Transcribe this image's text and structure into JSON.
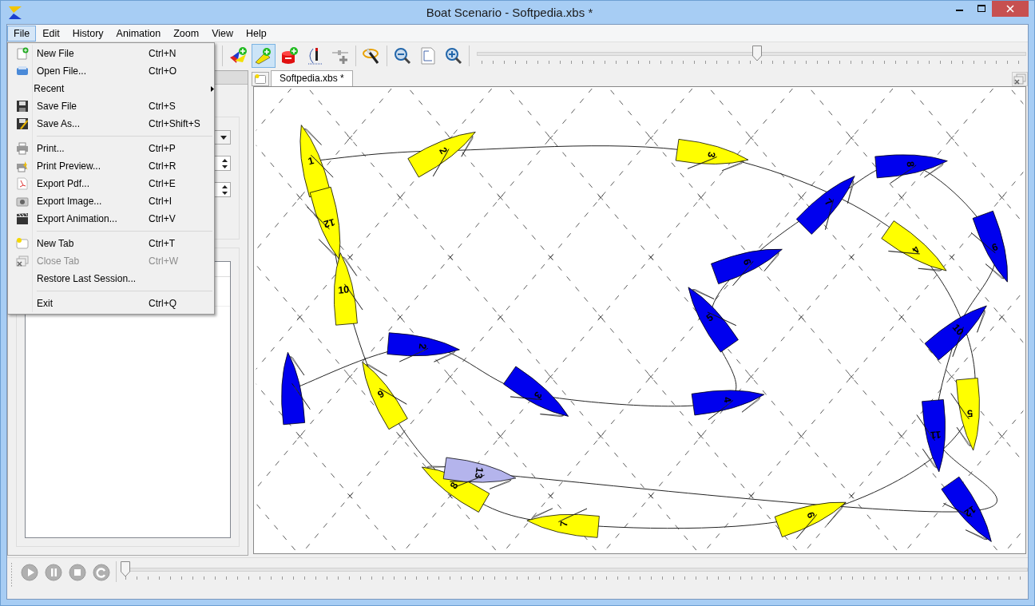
{
  "window": {
    "title": "Boat Scenario - Softpedia.xbs *"
  },
  "menu_bar": [
    {
      "label": "File",
      "selected": true
    },
    {
      "label": "Edit",
      "selected": false
    },
    {
      "label": "History",
      "selected": false
    },
    {
      "label": "Animation",
      "selected": false
    },
    {
      "label": "Zoom",
      "selected": false
    },
    {
      "label": "View",
      "selected": false
    },
    {
      "label": "Help",
      "selected": false
    }
  ],
  "file_menu": [
    {
      "kind": "item",
      "label": "New File",
      "shortcut": "Ctrl+N",
      "disabled": false
    },
    {
      "kind": "item",
      "label": "Open File...",
      "shortcut": "Ctrl+O",
      "disabled": false
    },
    {
      "kind": "submenu",
      "label": "Recent",
      "disabled": false
    },
    {
      "kind": "item",
      "label": "Save File",
      "shortcut": "Ctrl+S",
      "disabled": false
    },
    {
      "kind": "item",
      "label": "Save As...",
      "shortcut": "Ctrl+Shift+S",
      "disabled": false
    },
    {
      "kind": "separator"
    },
    {
      "kind": "item",
      "label": "Print...",
      "shortcut": "Ctrl+P",
      "disabled": false
    },
    {
      "kind": "item",
      "label": "Print Preview...",
      "shortcut": "Ctrl+R",
      "disabled": false
    },
    {
      "kind": "item",
      "label": "Export Pdf...",
      "shortcut": "Ctrl+E",
      "disabled": false
    },
    {
      "kind": "item",
      "label": "Export Image...",
      "shortcut": "Ctrl+I",
      "disabled": false
    },
    {
      "kind": "item",
      "label": "Export Animation...",
      "shortcut": "Ctrl+V",
      "disabled": false
    },
    {
      "kind": "separator"
    },
    {
      "kind": "item",
      "label": "New Tab",
      "shortcut": "Ctrl+T",
      "disabled": false
    },
    {
      "kind": "item",
      "label": "Close Tab",
      "shortcut": "Ctrl+W",
      "disabled": true
    },
    {
      "kind": "item",
      "label": "Restore Last Session...",
      "disabled": false
    },
    {
      "kind": "separator"
    },
    {
      "kind": "item",
      "label": "Exit",
      "shortcut": "Ctrl+Q",
      "disabled": false
    }
  ],
  "toolbar": {
    "tools": [
      {
        "selected": false
      },
      {
        "selected": true
      },
      {
        "selected": false
      },
      {
        "selected": false
      },
      {
        "selected": false
      },
      {
        "selected": false
      },
      {
        "selected": false
      },
      {
        "selected": false
      },
      {
        "selected": false
      }
    ],
    "zoom_slider": {
      "level": 0.51
    }
  },
  "document_tabs": [
    {
      "label": "Softpedia.xbs *",
      "selected": true
    }
  ],
  "scenario": {
    "boats": [
      {
        "label": "1",
        "color": "#ffff00"
      },
      {
        "label": "2",
        "color": "#ffff00"
      },
      {
        "label": "3",
        "color": "#ffff00"
      },
      {
        "label": "4",
        "color": "#ffff00"
      },
      {
        "label": "5",
        "color": "#ffff00"
      },
      {
        "label": "6",
        "color": "#ffff00"
      },
      {
        "label": "7",
        "color": "#ffff00"
      },
      {
        "label": "8",
        "color": "#ffff00"
      },
      {
        "label": "9",
        "color": "#ffff00"
      },
      {
        "label": "10",
        "color": "#ffff00"
      },
      {
        "label": "12",
        "color": "#ffff00"
      },
      {
        "color": "#0000ee"
      },
      {
        "label": "2",
        "color": "#0000ee"
      },
      {
        "label": "3",
        "color": "#0000ee"
      },
      {
        "label": "4",
        "color": "#0000ee"
      },
      {
        "label": "5",
        "color": "#0000ee"
      },
      {
        "label": "6",
        "color": "#0000ee"
      },
      {
        "label": "7",
        "color": "#0000ee"
      },
      {
        "label": "8",
        "color": "#0000ee"
      },
      {
        "label": "9",
        "color": "#0000ee"
      },
      {
        "label": "10",
        "color": "#0000ee"
      },
      {
        "label": "11",
        "color": "#0000ee"
      },
      {
        "label": "12",
        "color": "#0000ee"
      },
      {
        "label": "13",
        "color": "#b4b4ec"
      }
    ]
  },
  "animation": {
    "timeline": {
      "level": 0
    }
  }
}
